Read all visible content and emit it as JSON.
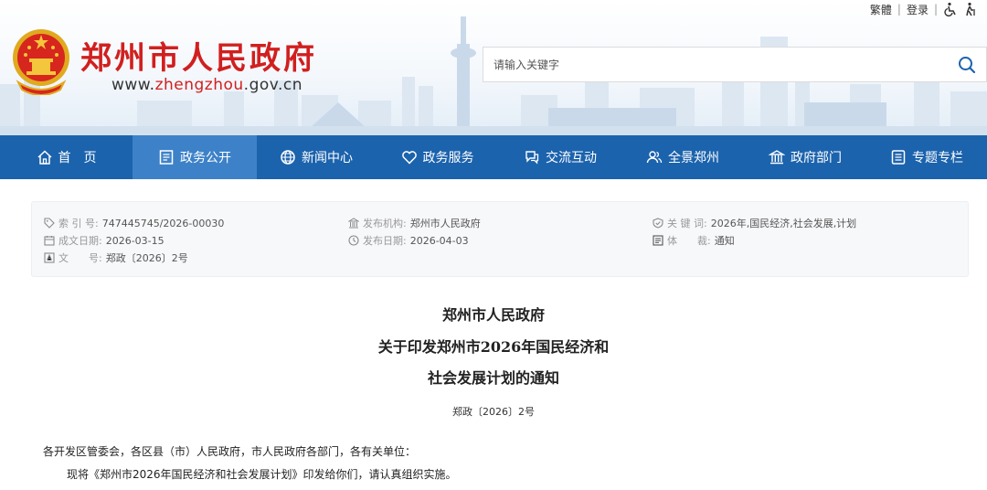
{
  "toplinks": {
    "traditional": "繁體",
    "login": "登录",
    "accessibility_icon": "wheelchair-icon",
    "elder_icon": "elder-icon"
  },
  "brand": {
    "title": "郑州市人民政府",
    "url_prefix": "www.",
    "url_highlight": "zhengzhou",
    "url_suffix": ".gov.cn",
    "emblem_icon": "national-emblem"
  },
  "search": {
    "placeholder": "请输入关键字",
    "value": "",
    "icon": "search-icon"
  },
  "nav": {
    "items": [
      {
        "label": "首　页",
        "icon": "home-icon",
        "active": false
      },
      {
        "label": "政务公开",
        "icon": "document-icon",
        "active": true
      },
      {
        "label": "新闻中心",
        "icon": "globe-icon",
        "active": false
      },
      {
        "label": "政务服务",
        "icon": "heart-icon",
        "active": false
      },
      {
        "label": "交流互动",
        "icon": "chat-icon",
        "active": false
      },
      {
        "label": "全景郑州",
        "icon": "users-icon",
        "active": false
      },
      {
        "label": "政府部门",
        "icon": "building-icon",
        "active": false
      },
      {
        "label": "专题专栏",
        "icon": "list-icon",
        "active": false
      }
    ]
  },
  "info": {
    "index_label": "索 引 号:",
    "index_value": "747445745/2026-00030",
    "org_label": "发布机构:",
    "org_value": "郑州市人民政府",
    "keyword_label": "关 键 词:",
    "keyword_value": "2026年,国民经济,社会发展,计划",
    "created_label": "成文日期:",
    "created_value": "2026-03-15",
    "published_label": "发布日期:",
    "published_value": "2026-04-03",
    "genre_label": "体　　裁:",
    "genre_value": "通知",
    "docno_label": "文　　号:",
    "docno_value": "郑政〔2026〕2号"
  },
  "article": {
    "title_line1": "郑州市人民政府",
    "title_line2": "关于印发郑州市2026年国民经济和",
    "title_line3": "社会发展计划的通知",
    "doc_number": "郑政〔2026〕2号",
    "salutation": "各开发区管委会，各区县（市）人民政府，市人民政府各部门，各有关单位：",
    "body_line1": "现将《郑州市2026年国民经济和社会发展计划》印发给你们，请认真组织实施。"
  },
  "colors": {
    "brand_red": "#d11f1f",
    "nav_blue": "#1c63ad",
    "nav_active": "#3d82c8",
    "info_bg": "#f7f8fa"
  }
}
